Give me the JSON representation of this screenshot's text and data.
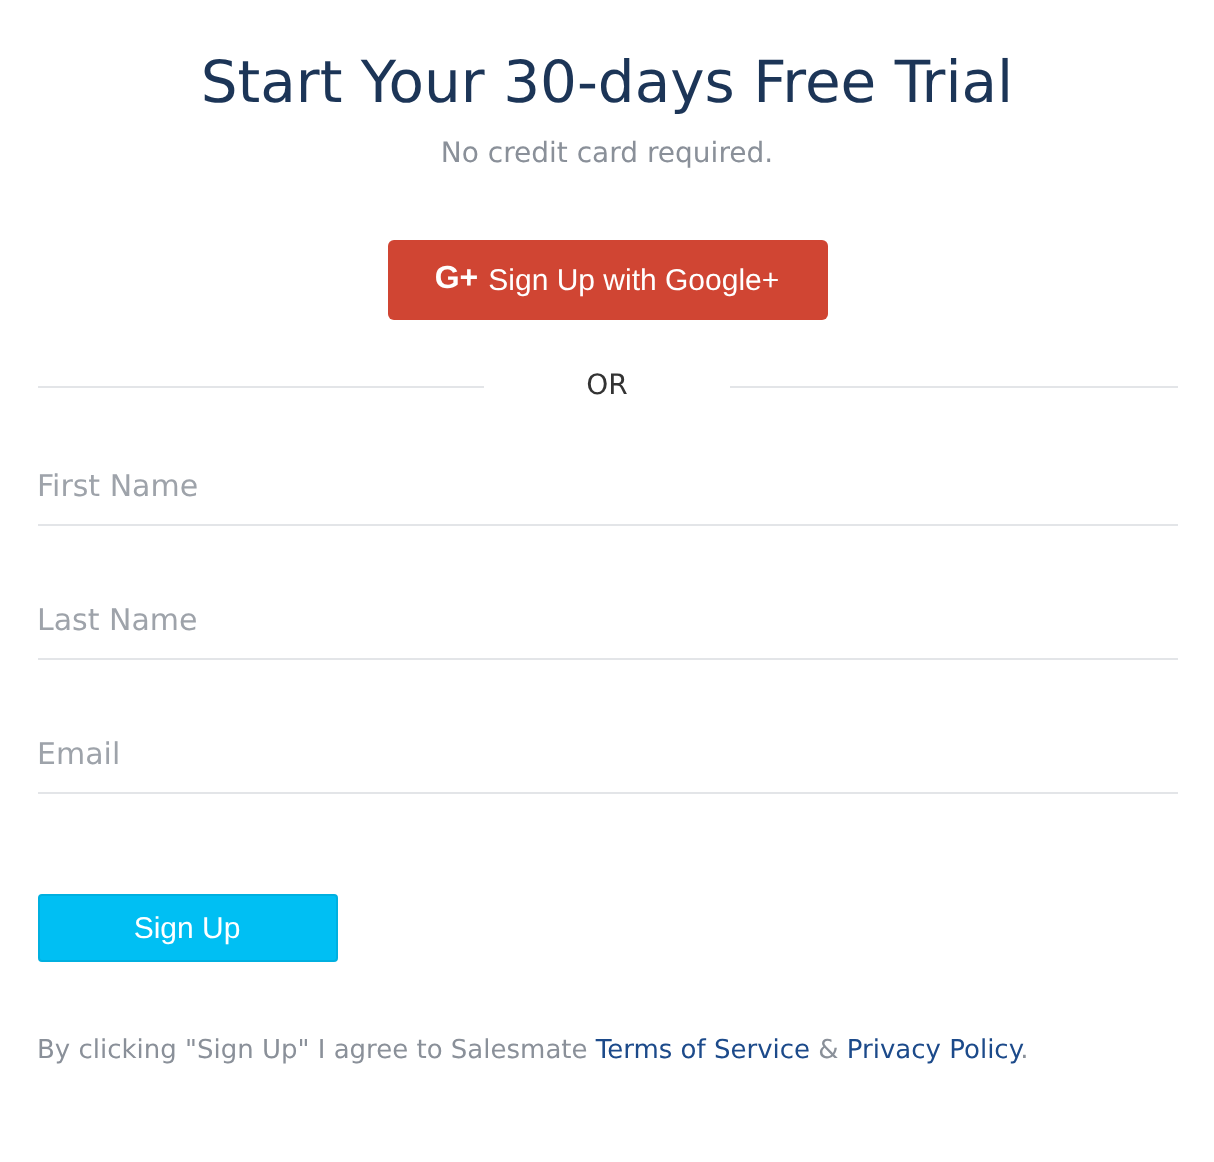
{
  "title": "Start Your 30-days Free Trial",
  "subtitle": "No credit card required.",
  "google_button": {
    "icon": "G+",
    "label": "Sign Up with Google+"
  },
  "divider_label": "OR",
  "fields": [
    {
      "placeholder": "First Name"
    },
    {
      "placeholder": "Last Name"
    },
    {
      "placeholder": "Email"
    }
  ],
  "submit_button": "Sign Up",
  "legal": [
    {
      "kind": "text",
      "text": "By clicking \"Sign Up\" I agree to Salesmate "
    },
    {
      "kind": "link",
      "text": "Terms of Service"
    },
    {
      "kind": "text",
      "text": " & "
    },
    {
      "kind": "link",
      "text": "Privacy Policy"
    },
    {
      "kind": "text",
      "text": "."
    }
  ]
}
